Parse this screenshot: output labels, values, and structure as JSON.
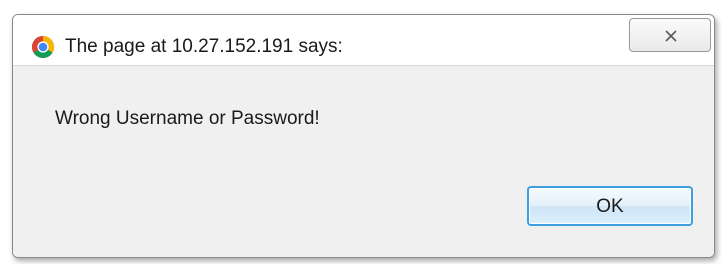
{
  "dialog": {
    "title": "The page at 10.27.152.191 says:",
    "title_icon": "chrome-icon",
    "close_icon": "close-icon",
    "message": "Wrong Username or Password!",
    "ok_label": "OK"
  },
  "colors": {
    "content_background": "#f0f0f0",
    "ok_button_border": "#3c9fe0"
  }
}
